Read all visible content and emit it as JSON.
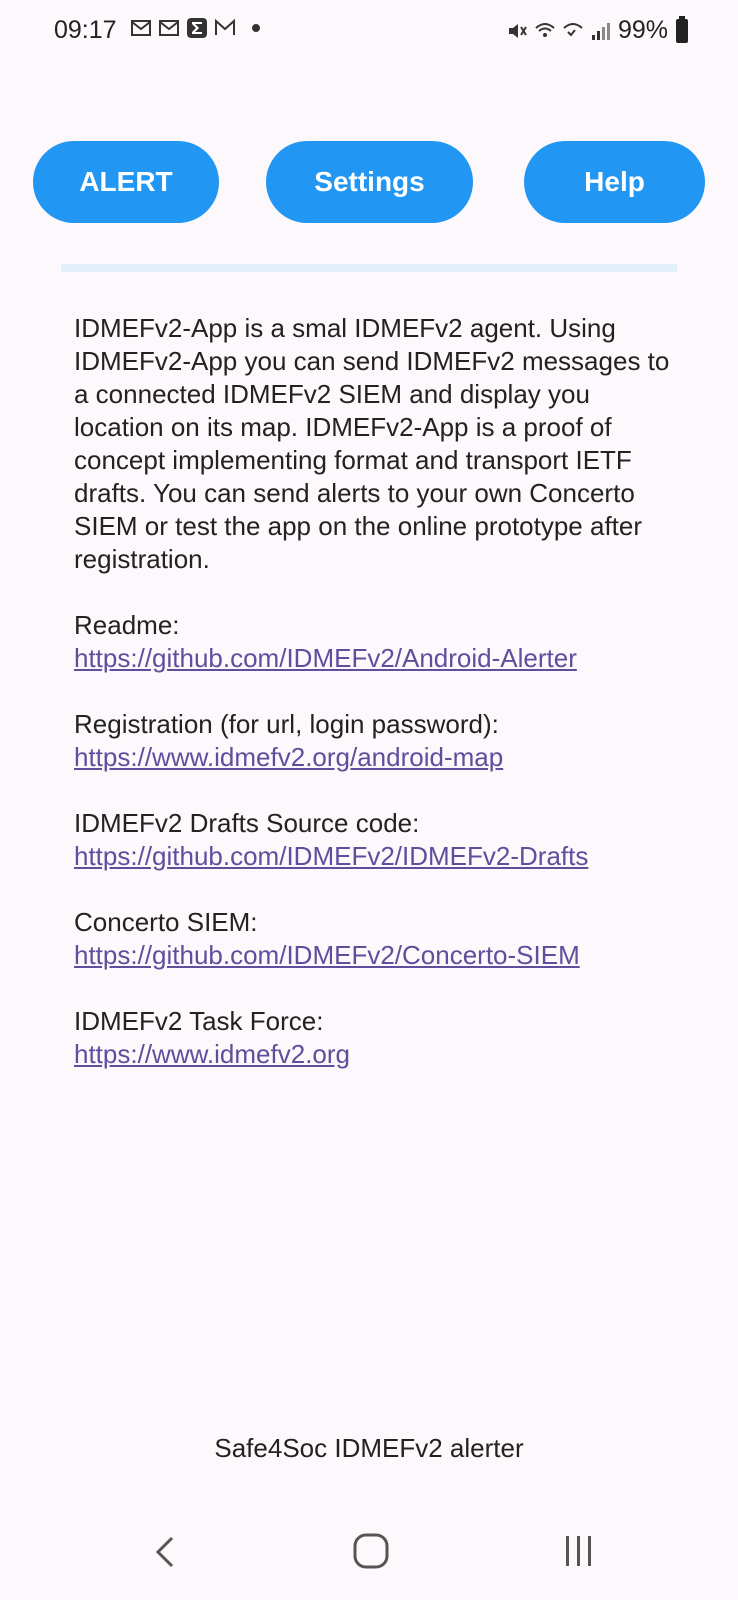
{
  "status_bar": {
    "time": "09:17",
    "battery": "99%"
  },
  "buttons": {
    "alert": "ALERT",
    "settings": "Settings",
    "help": "Help"
  },
  "content": {
    "intro": "IDMEFv2-App is a smal IDMEFv2 agent. Using IDMEFv2-App you can send IDMEFv2 messages to a connected IDMEFv2 SIEM and display you location on its map. IDMEFv2-App is a proof of concept implementing format and transport IETF drafts. You can send alerts to your own Concerto SIEM or test the app on the online prototype after registration.",
    "sections": [
      {
        "label": "Readme:",
        "link": "https://github.com/IDMEFv2/Android-Alerter"
      },
      {
        "label": "Registration (for url, login password):",
        "link": "https://www.idmefv2.org/android-map"
      },
      {
        "label": "IDMEFv2 Drafts Source code:",
        "link": "https://github.com/IDMEFv2/IDMEFv2-Drafts"
      },
      {
        "label": "Concerto SIEM:",
        "link": "https://github.com/IDMEFv2/Concerto-SIEM"
      },
      {
        "label": "IDMEFv2 Task Force:",
        "link": "https://www.idmefv2.org"
      }
    ]
  },
  "footer": "Safe4Soc IDMEFv2 alerter",
  "colors": {
    "button": "#2196f3",
    "link": "#5c4f9c",
    "background": "#fcf8fc"
  }
}
